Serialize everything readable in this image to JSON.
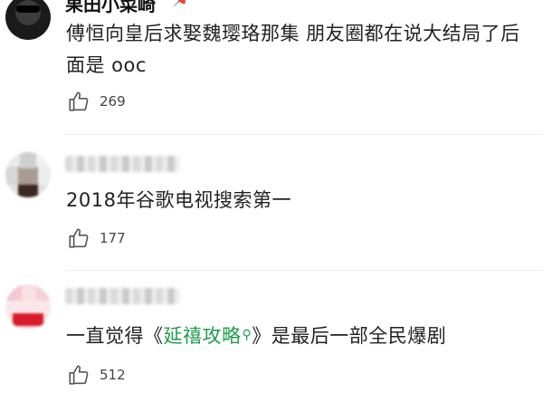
{
  "comments": [
    {
      "username": "果田小菜崎",
      "text": "傅恒向皇后求娶魏璎珞那集 朋友圈都在说大结局了后面是 ooc",
      "likes": "269"
    },
    {
      "username": "",
      "text": "2018年谷歌电视搜索第一",
      "likes": "177"
    },
    {
      "username": "",
      "text_before": "一直觉得《",
      "link_text": "延禧攻略",
      "text_after": "》是最后一部全民爆剧",
      "likes": "512"
    }
  ],
  "colors": {
    "link": "#1e9c4e",
    "text": "#222222",
    "meta": "#444444"
  },
  "icons": {
    "like": "thumbs-up-icon",
    "search": "search-icon"
  }
}
